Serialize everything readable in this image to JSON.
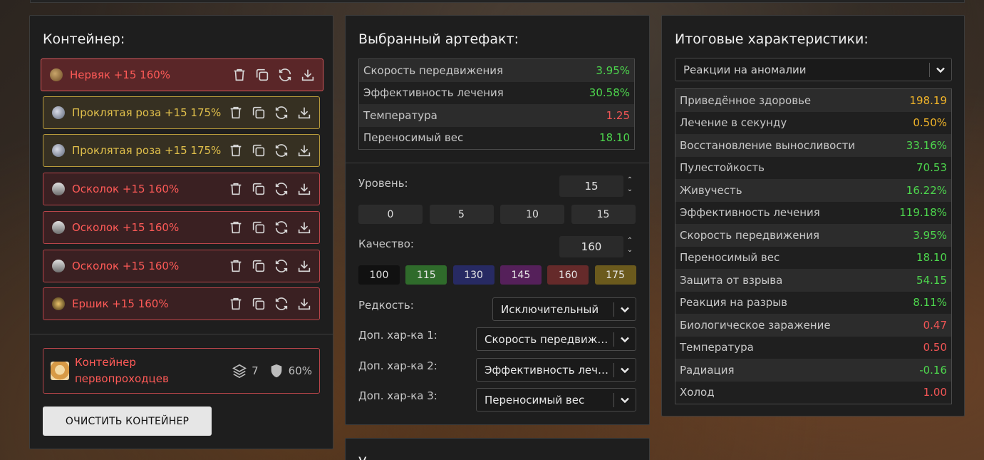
{
  "container": {
    "title": "Контейнер:",
    "items": [
      {
        "name": "Нервяк +15 160%",
        "color": "red",
        "selected": true,
        "icon": "nervyak-artifact-icon"
      },
      {
        "name": "Проклятая роза +15 175%",
        "color": "gold",
        "icon": "cursed-rose-artifact-icon"
      },
      {
        "name": "Проклятая роза +15 175%",
        "color": "gold",
        "icon": "cursed-rose-artifact-icon"
      },
      {
        "name": "Осколок +15 160%",
        "color": "red",
        "icon": "shard-artifact-icon"
      },
      {
        "name": "Осколок +15 160%",
        "color": "red",
        "icon": "shard-artifact-icon"
      },
      {
        "name": "Осколок +15 160%",
        "color": "red",
        "icon": "shard-artifact-icon"
      },
      {
        "name": "Ершик +15 160%",
        "color": "red",
        "icon": "ershik-artifact-icon"
      }
    ],
    "item_actions": [
      "trash-icon",
      "copy-icon",
      "swap-icon",
      "download-icon"
    ],
    "card": {
      "name": "Контейнер первопроходцев",
      "slots": "7",
      "protection": "60%"
    },
    "clear_button": "ОЧИСТИТЬ КОНТЕЙНЕР"
  },
  "artifact": {
    "title": "Выбранный артефакт:",
    "stats": [
      {
        "label": "Скорость передвижения",
        "value": "3.95%",
        "color": "g"
      },
      {
        "label": "Эффективность лечения",
        "value": "30.58%",
        "color": "g"
      },
      {
        "label": "Температура",
        "value": "1.25",
        "color": "r"
      },
      {
        "label": "Переносимый вес",
        "value": "18.10",
        "color": "g"
      }
    ],
    "level_label": "Уровень:",
    "level_value": "15",
    "level_presets": [
      "0",
      "5",
      "10",
      "15"
    ],
    "quality_label": "Качество:",
    "quality_value": "160",
    "quality_presets": [
      {
        "label": "100",
        "color": "#111111"
      },
      {
        "label": "115",
        "color": "#2f6b2b"
      },
      {
        "label": "130",
        "color": "#272a63"
      },
      {
        "label": "145",
        "color": "#55205a"
      },
      {
        "label": "160",
        "color": "#652a2a"
      },
      {
        "label": "175",
        "color": "#6b5a1d"
      }
    ],
    "rarity_label": "Редкость:",
    "rarity_value": "Исключительный",
    "extra1_label": "Доп. хар-ка 1:",
    "extra1_value": "Скорость передвижения",
    "extra2_label": "Доп. хар-ка 2:",
    "extra2_value": "Эффективность лечения",
    "extra3_label": "Доп. хар-ка 3:",
    "extra3_value": "Переносимый вес"
  },
  "totals": {
    "title": "Итоговые характеристики:",
    "filter_value": "Реакции на аномалии",
    "stats": [
      {
        "label": "Приведённое здоровье",
        "value": "198.19",
        "color": "y"
      },
      {
        "label": "Лечение в секунду",
        "value": "0.50%",
        "color": "y"
      },
      {
        "label": "Восстановление выносливости",
        "value": "33.16%",
        "color": "g"
      },
      {
        "label": "Пулестойкость",
        "value": "70.53",
        "color": "g"
      },
      {
        "label": "Живучесть",
        "value": "16.22%",
        "color": "g"
      },
      {
        "label": "Эффективность лечения",
        "value": "119.18%",
        "color": "g"
      },
      {
        "label": "Скорость передвижения",
        "value": "3.95%",
        "color": "g"
      },
      {
        "label": "Переносимый вес",
        "value": "18.10",
        "color": "g"
      },
      {
        "label": "Защита от взрыва",
        "value": "54.15",
        "color": "g"
      },
      {
        "label": "Реакция на разрыв",
        "value": "8.11%",
        "color": "g"
      },
      {
        "label": "Биологическое заражение",
        "value": "0.47",
        "color": "r"
      },
      {
        "label": "Температура",
        "value": "0.50",
        "color": "r"
      },
      {
        "label": "Радиация",
        "value": "-0.16",
        "color": "g"
      },
      {
        "label": "Холод",
        "value": "1.00",
        "color": "r"
      }
    ]
  },
  "bottom_panel": {
    "title": "У"
  }
}
